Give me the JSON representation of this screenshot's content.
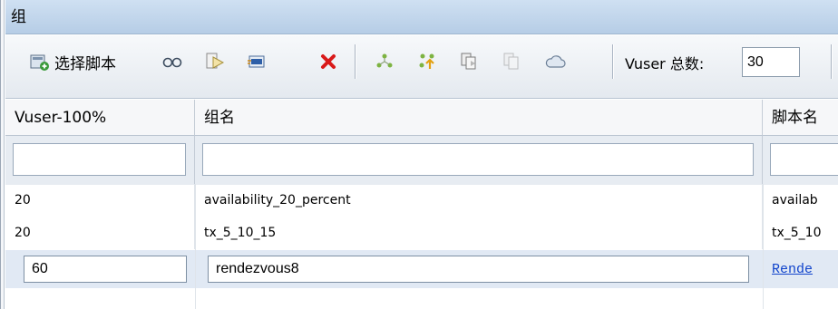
{
  "panel": {
    "title": "组"
  },
  "toolbar": {
    "select_script_label": "选择脚本",
    "icons": [
      "select-script-icon",
      "details-icon",
      "run-icon",
      "generator-icon",
      "delete-icon",
      "assign-icon",
      "add-load-icon",
      "copy-icon",
      "paste-icon",
      "cloud-icon"
    ],
    "vuser_total_label": "Vuser 总数:",
    "vuser_total_value": "30"
  },
  "grid": {
    "columns": [
      "Vuser-100%",
      "组名",
      "脚本名"
    ],
    "rows": [
      {
        "percent": "20",
        "group": "availability_20_percent",
        "script": "availab"
      },
      {
        "percent": "20",
        "group": "tx_5_10_15",
        "script": "tx_5_10"
      },
      {
        "percent": "60",
        "group": "rendezvous8",
        "script": "Rende"
      }
    ]
  },
  "colors": {
    "title_bar": "#b6cde6",
    "selected_row": "#e1e9f4",
    "link": "#1144cc",
    "delete_red": "#d91a1a"
  }
}
